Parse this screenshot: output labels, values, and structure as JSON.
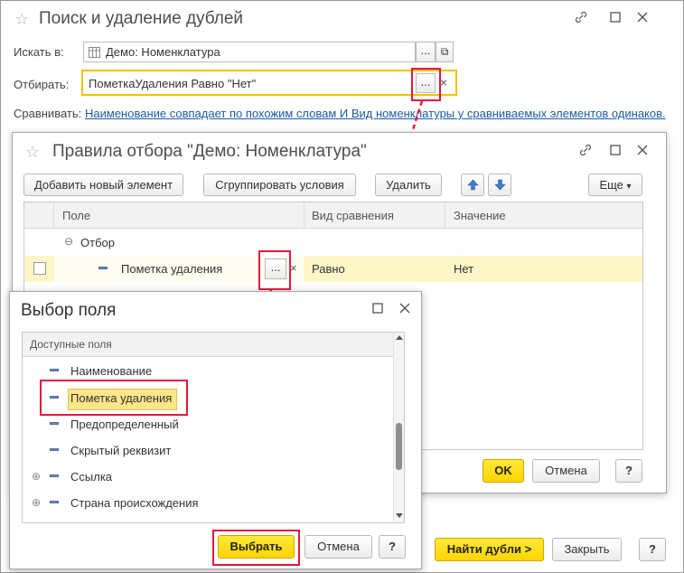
{
  "main": {
    "title": "Поиск и удаление дублей",
    "search_in_label": "Искать в:",
    "search_in_value": "Демо: Номенклатура",
    "filter_label": "Отбирать:",
    "filter_value": "ПометкаУдаления Равно \"Нет\"",
    "compare_label": "Сравнивать:",
    "compare_link": "Наименование совпадает по похожим словам И Вид номенклатуры у сравниваемых элементов одинаков.",
    "find_button": "Найти дубли >",
    "close_button": "Закрыть",
    "help_button": "?"
  },
  "rules": {
    "title": "Правила отбора \"Демо: Номенклатура\"",
    "add_button": "Добавить новый элемент",
    "group_button": "Сгруппировать условия",
    "delete_button": "Удалить",
    "more_button": "Еще",
    "columns": [
      "Поле",
      "Вид сравнения",
      "Значение"
    ],
    "group_row": "Отбор",
    "row": {
      "field": "Пометка удаления",
      "comparison": "Равно",
      "value": "Нет"
    },
    "ok_button": "OK",
    "cancel_button": "Отмена",
    "help_button": "?"
  },
  "picker": {
    "title": "Выбор поля",
    "header": "Доступные поля",
    "items": [
      "Наименование",
      "Пометка удаления",
      "Предопределенный",
      "Скрытый реквизит",
      "Ссылка",
      "Страна происхождения"
    ],
    "select_button": "Выбрать",
    "cancel_button": "Отмена",
    "help_button": "?"
  },
  "glyphs": {
    "star": "☆",
    "link": "🔗",
    "maximize": "☐",
    "close": "✕",
    "ellipsis": "...",
    "clear": "×",
    "collapse": "⊖",
    "expand": "⊕",
    "up": "⬆",
    "down": "⬇",
    "dropdown": "▾",
    "open": "⧉"
  },
  "colors": {
    "accent_yellow": "#ffd500",
    "highlight_red": "#e3183f",
    "selected_row": "#fff6c8"
  }
}
